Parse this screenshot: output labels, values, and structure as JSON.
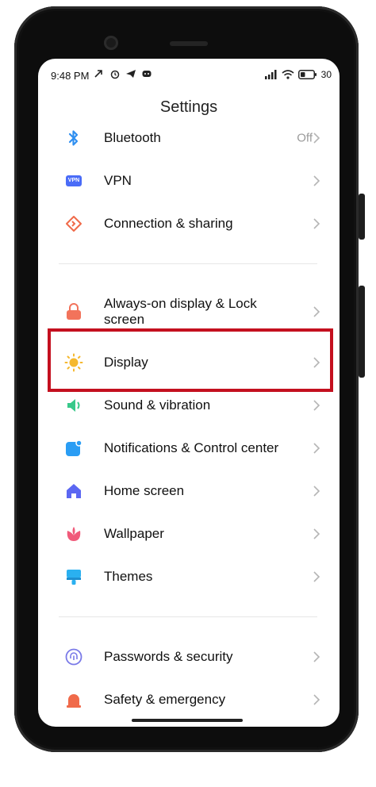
{
  "status_bar": {
    "time": "9:48 PM",
    "battery": "30"
  },
  "header": {
    "title": "Settings"
  },
  "items": [
    {
      "label": "Bluetooth",
      "value": "Off"
    },
    {
      "label": "VPN",
      "icon_text": "VPN"
    },
    {
      "label": "Connection & sharing"
    },
    {
      "label": "Always-on display & Lock screen"
    },
    {
      "label": "Display"
    },
    {
      "label": "Sound & vibration"
    },
    {
      "label": "Notifications & Control center"
    },
    {
      "label": "Home screen"
    },
    {
      "label": "Wallpaper"
    },
    {
      "label": "Themes"
    },
    {
      "label": "Passwords & security"
    },
    {
      "label": "Safety & emergency"
    }
  ],
  "icons": {
    "bluetooth": "bluetooth-icon",
    "vpn": "vpn-icon",
    "connection": "connection-sharing-icon",
    "lock": "lock-icon",
    "display": "sun-icon",
    "sound": "speaker-icon",
    "notifications": "notification-icon",
    "home": "home-icon",
    "wallpaper": "flower-icon",
    "themes": "paintbrush-icon",
    "passwords": "fingerprint-icon",
    "safety": "siren-icon"
  },
  "colors": {
    "bluetooth": "#2f8ff0",
    "vpn": "#4a6cf7",
    "connection": "#f06a4a",
    "lock": "#f2735b",
    "display": "#f5b82e",
    "sound": "#38c98a",
    "notifications": "#2a9df4",
    "home": "#5b67f2",
    "wallpaper": "#f05a7a",
    "themes": "#2ab0f0",
    "passwords": "#7a7ae8",
    "safety": "#f06a4a",
    "highlight": "#c4101f"
  }
}
